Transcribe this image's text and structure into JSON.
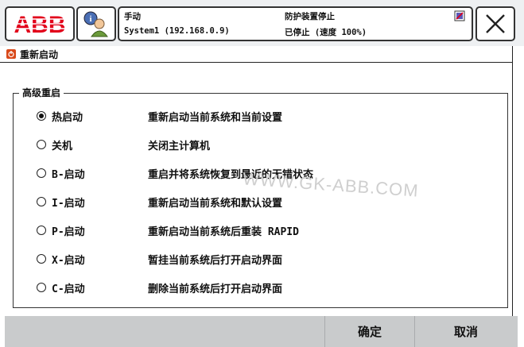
{
  "top": {
    "logo_text": "ABB",
    "mode": "手动",
    "system": "System1 (192.168.0.9)",
    "guard": "防护装置停止",
    "stopped": "已停止 (速度 100%)"
  },
  "window": {
    "title": "重新启动"
  },
  "group": {
    "legend": "高级重启",
    "options": [
      {
        "label": "热启动",
        "desc": "重新启动当前系统和当前设置",
        "selected": true
      },
      {
        "label": "关机",
        "desc": "关闭主计算机",
        "selected": false
      },
      {
        "label": "B-启动",
        "desc": "重启并将系统恢复到最近的无错状态",
        "selected": false
      },
      {
        "label": "I-启动",
        "desc": "重新启动当前系统和默认设置",
        "selected": false
      },
      {
        "label": "P-启动",
        "desc": "重新启动当前系统后重装 RAPID",
        "selected": false
      },
      {
        "label": "X-启动",
        "desc": "暂挂当前系统后打开启动界面",
        "selected": false
      },
      {
        "label": "C-启动",
        "desc": "删除当前系统后打开启动界面",
        "selected": false
      }
    ]
  },
  "watermark": "WWW.GK-ABB.COM",
  "buttons": {
    "ok": "确定",
    "cancel": "取消"
  },
  "colors": {
    "brand_red": "#e2001a",
    "title_icon": "#d9491a",
    "bottom_bar": "#c9cbcc"
  }
}
